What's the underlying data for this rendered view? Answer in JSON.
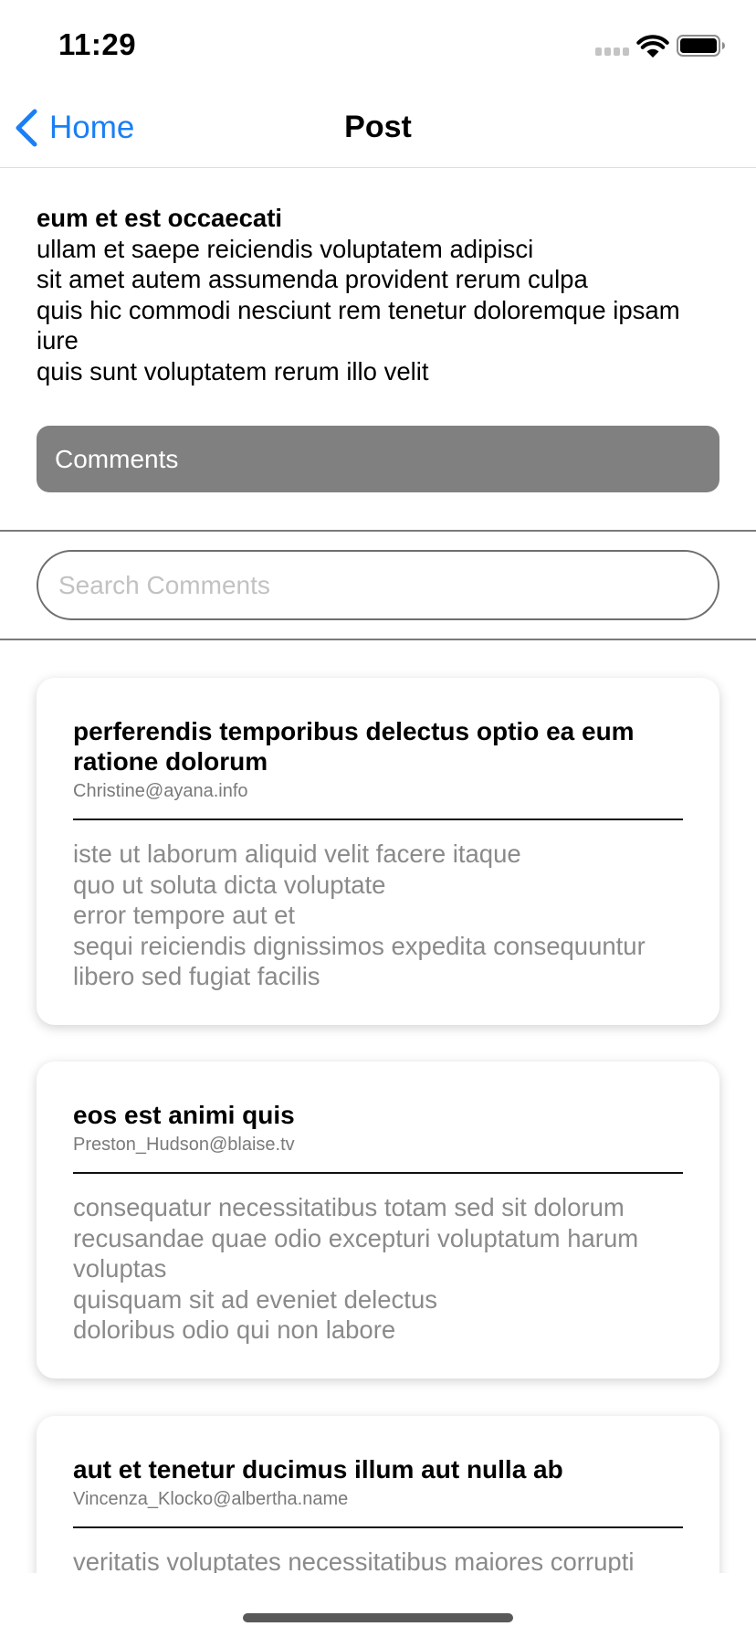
{
  "status_bar": {
    "time": "11:29"
  },
  "nav": {
    "back_label": "Home",
    "title": "Post"
  },
  "post": {
    "title": "eum et est occaecati",
    "body": "ullam et saepe reiciendis voluptatem adipisci\nsit amet autem assumenda provident rerum culpa\nquis hic commodi nesciunt rem tenetur doloremque ipsam iure\nquis sunt voluptatem rerum illo velit"
  },
  "comments_button": {
    "label": "Comments"
  },
  "search": {
    "placeholder": "Search Comments",
    "value": ""
  },
  "comments": [
    {
      "title": "perferendis temporibus delectus optio ea eum ratione dolorum",
      "email": "Christine@ayana.info",
      "body": "iste ut laborum aliquid velit facere itaque\nquo ut soluta dicta voluptate\nerror tempore aut et\nsequi reiciendis dignissimos expedita consequuntur libero sed fugiat facilis"
    },
    {
      "title": "eos est animi quis",
      "email": "Preston_Hudson@blaise.tv",
      "body": "consequatur necessitatibus totam sed sit dolorum\nrecusandae quae odio excepturi voluptatum harum voluptas\nquisquam sit ad eveniet delectus\ndoloribus odio qui non labore"
    },
    {
      "title": "aut et tenetur ducimus illum aut nulla ab",
      "email": "Vincenza_Klocko@albertha.name",
      "body": "veritatis voluptates necessitatibus maiores corrupti"
    }
  ],
  "colors": {
    "accent": "#1a7ff5",
    "button_bg": "#808080",
    "muted_text": "#8a8a8a"
  },
  "icons": {
    "back": "chevron-left-icon",
    "signal": "cellular-signal-icon",
    "wifi": "wifi-icon",
    "battery": "battery-icon"
  }
}
